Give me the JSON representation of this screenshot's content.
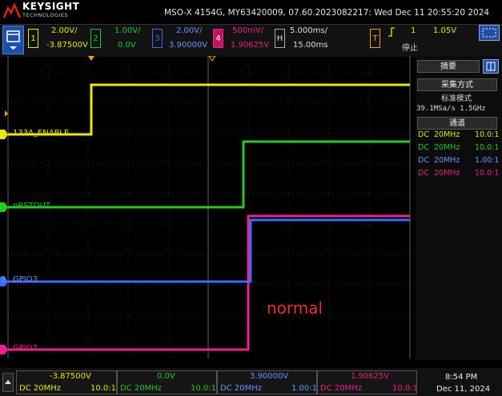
{
  "header": {
    "brand": "KEYSIGHT",
    "brand_sub": "TECHNOLOGIES",
    "model_line": "MSO-X 4154G, MY63420009, 07.60.2023082217: Wed Dec 11 20:55:20 2024"
  },
  "toolbar": {
    "channels": [
      {
        "num": "1",
        "scale": "2.00V/",
        "offset": "-3.87500V",
        "color": "#e8e800"
      },
      {
        "num": "2",
        "scale": "1.00V/",
        "offset": "0.0V",
        "color": "#22cc22"
      },
      {
        "num": "3",
        "scale": "2.00V/",
        "offset": "3.90000V",
        "color": "#3a6cff"
      },
      {
        "num": "4",
        "scale": "500mV/",
        "offset": "1.90625V",
        "color": "#ee2288"
      }
    ],
    "horizontal": {
      "label": "H",
      "scale": "5.000ms/",
      "position": "15.00ms"
    },
    "trigger": {
      "label": "T",
      "channel": "1",
      "level": "1.05V",
      "status": "停止"
    }
  },
  "traces": [
    {
      "label": "133A_ENABLE",
      "marker": "1",
      "color": "#e8e800"
    },
    {
      "label": "nRSTOUT",
      "marker": "2",
      "color": "#22cc22"
    },
    {
      "label": "GPIO3",
      "marker": "3",
      "color": "#3a6cff"
    },
    {
      "label": "GPIO7",
      "marker": "4",
      "color": "#ee2288"
    }
  ],
  "annotation": "normal",
  "panel": {
    "summary_title": "摘要",
    "acq_title": "采集方式",
    "acq_mode": "标准模式",
    "sample_rate": "39.1MSa/s  1.5GHz",
    "channels_title": "通道",
    "channel_rows": [
      {
        "coupling": "DC",
        "bw": "20MHz",
        "probe": "10.0:1",
        "color": "#e8e800"
      },
      {
        "coupling": "DC",
        "bw": "20MHz",
        "probe": "10.0:1",
        "color": "#22cc22"
      },
      {
        "coupling": "DC",
        "bw": "20MHz",
        "probe": "1.00:1",
        "color": "#3a6cff"
      },
      {
        "coupling": "DC",
        "bw": "20MHz",
        "probe": "10.0:1",
        "color": "#ee2288"
      }
    ]
  },
  "bottom": {
    "cells": [
      {
        "offset": "-3.87500V",
        "coupling": "DC 20MHz",
        "probe": "10.0:1",
        "color": "#e8e800"
      },
      {
        "offset": "0.0V",
        "coupling": "DC 20MHz",
        "probe": "10.0:1",
        "color": "#22cc22"
      },
      {
        "offset": "3.90000V",
        "coupling": "DC 20MHz",
        "probe": "1.00:1",
        "color": "#3a6cff"
      },
      {
        "offset": "1.90625V",
        "coupling": "DC 20MHz",
        "probe": "10.0:1",
        "color": "#ee2288"
      }
    ],
    "time": "8:54 PM",
    "date": "Dec 11, 2024"
  }
}
